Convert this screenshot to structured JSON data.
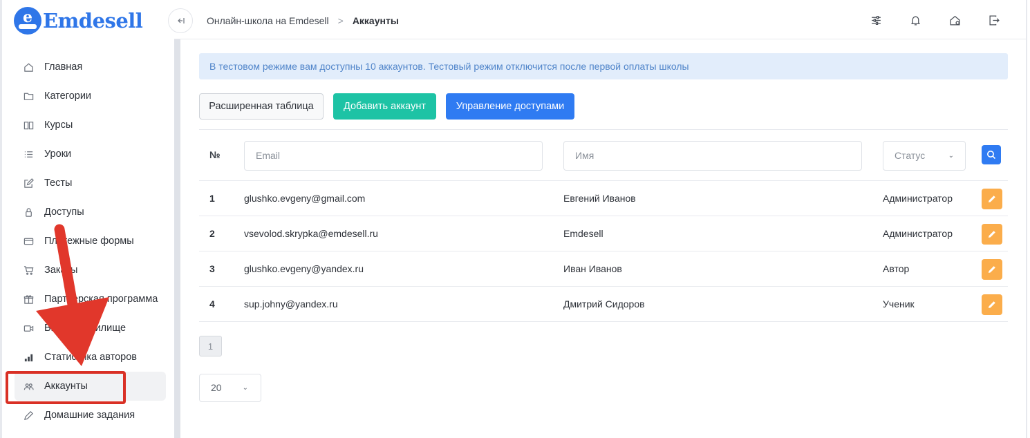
{
  "brand": {
    "name": "Emdesell",
    "logo_letter": "e",
    "color": "#2f76e8"
  },
  "sidebar": {
    "items": [
      {
        "label": "Главная",
        "icon": "home-icon"
      },
      {
        "label": "Категории",
        "icon": "folder-icon"
      },
      {
        "label": "Курсы",
        "icon": "book-icon"
      },
      {
        "label": "Уроки",
        "icon": "list-icon"
      },
      {
        "label": "Тесты",
        "icon": "edit-icon"
      },
      {
        "label": "Доступы",
        "icon": "lock-icon"
      },
      {
        "label": "Платежные формы",
        "icon": "card-icon"
      },
      {
        "label": "Заказы",
        "icon": "cart-icon"
      },
      {
        "label": "Партнерская программа",
        "icon": "gift-icon"
      },
      {
        "label": "Видеохранилище",
        "icon": "video-icon"
      },
      {
        "label": "Статистика авторов",
        "icon": "bar-chart-icon"
      },
      {
        "label": "Аккаунты",
        "icon": "users-icon",
        "active": true
      },
      {
        "label": "Домашние задания",
        "icon": "pencil-icon"
      }
    ]
  },
  "header": {
    "breadcrumb": {
      "parent": "Онлайн-школа на Emdesell",
      "separator": ">",
      "current": "Аккаунты"
    },
    "icons": [
      "sliders-icon",
      "bell-icon",
      "home-settings-icon",
      "logout-icon"
    ]
  },
  "main": {
    "alert": "В тестовом режиме вам доступны 10 аккаунтов. Тестовый режим отключится после первой оплаты школы",
    "buttons": {
      "extended_table": "Расширенная таблица",
      "add_account": "Добавить аккаунт",
      "access_management": "Управление доступами"
    },
    "filters": {
      "number_header": "№",
      "email_placeholder": "Email",
      "name_placeholder": "Имя",
      "status_placeholder": "Статус"
    },
    "rows": [
      {
        "num": "1",
        "email": "glushko.evgeny@gmail.com",
        "name": "Евгений Иванов",
        "role": "Администратор"
      },
      {
        "num": "2",
        "email": "vsevolod.skrypka@emdesell.ru",
        "name": "Emdesell",
        "role": "Администратор"
      },
      {
        "num": "3",
        "email": "glushko.evgeny@yandex.ru",
        "name": "Иван Иванов",
        "role": "Автор"
      },
      {
        "num": "4",
        "email": "sup.johny@yandex.ru",
        "name": "Дмитрий Сидоров",
        "role": "Ученик"
      }
    ],
    "pagination": {
      "current_page": "1"
    },
    "per_page": "20"
  },
  "colors": {
    "accent": "#2f7bf2",
    "success": "#1dc3a5",
    "warning": "#fbad4b",
    "annotation": "#d93025"
  }
}
